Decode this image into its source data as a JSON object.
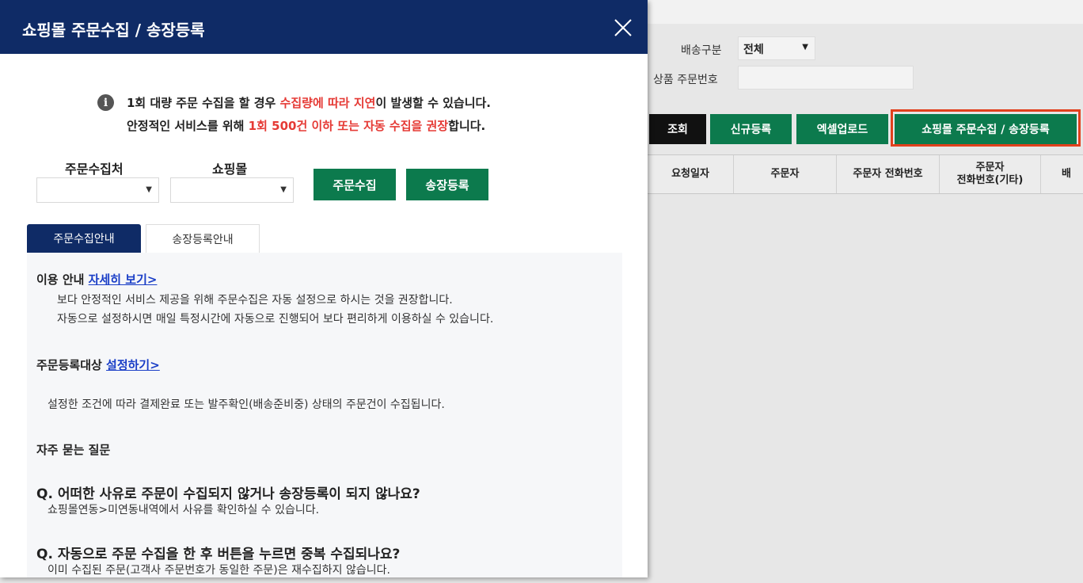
{
  "modal": {
    "title": "쇼핑몰 주문수집 / 송장등록",
    "notice": {
      "line1_a": "1회 대량 주문 수집을 할 경우 ",
      "line1_red": "수집량에 따라 지연",
      "line1_b": "이 발생할 수 있습니다.",
      "line2_a": "안정적인 서비스를 위해 ",
      "line2_red": "1회 500건 이하 또는 자동 수집을 권장",
      "line2_b": "합니다."
    },
    "filters": {
      "source_label": "주문수집처",
      "mall_label": "쇼핑몰",
      "collect_btn": "주문수집",
      "invoice_btn": "송장등록"
    },
    "tabs": [
      "주문수집안내",
      "송장등록안내"
    ],
    "guide": {
      "usage_title": "이용 안내 ",
      "usage_link": "자세히 보기>",
      "usage_line1": "보다 안정적인 서비스 제공을 위해 주문수집은 자동 설정으로 하시는 것을 권장합니다.",
      "usage_line2": "자동으로 설정하시면 매일 특정시간에 자동으로 진행되어 보다 편리하게 이용하실 수 있습니다.",
      "target_title": "주문등록대상 ",
      "target_link": "설정하기>",
      "target_line": "설정한 조건에 따라 결제완료 또는 발주확인(배송준비중) 상태의 주문건이 수집됩니다.",
      "faq_title": "자주 묻는 질문",
      "q1": "Q. 어떠한 사유로 주문이 수집되지 않거나 송장등록이 되지 않나요?",
      "a1": "쇼핑몰연동>미연동내역에서 사유를 확인하실 수 있습니다.",
      "q2": "Q. 자동으로 주문 수집을 한 후 버튼을 누르면 중복 수집되나요?",
      "a2": "이미 수집된 주문(고객사 주문번호가 동일한 주문)은 재수집하지 않습니다."
    }
  },
  "background": {
    "delivery_label": "배송구분",
    "delivery_value": "전체",
    "order_no_label": "상품 주문번호",
    "buttons": [
      "조회",
      "신규등록",
      "엑셀업로드",
      "쇼핑몰 주문수집 / 송장등록"
    ],
    "table_headers": [
      "요청일자",
      "주문자",
      "주문자 전화번호",
      "주문자\n전화번호(기타)",
      "배"
    ]
  },
  "colors": {
    "navy": "#0f2b66",
    "green": "#0c7a4d",
    "red": "#e53a35",
    "highlight": "#e2401c"
  }
}
